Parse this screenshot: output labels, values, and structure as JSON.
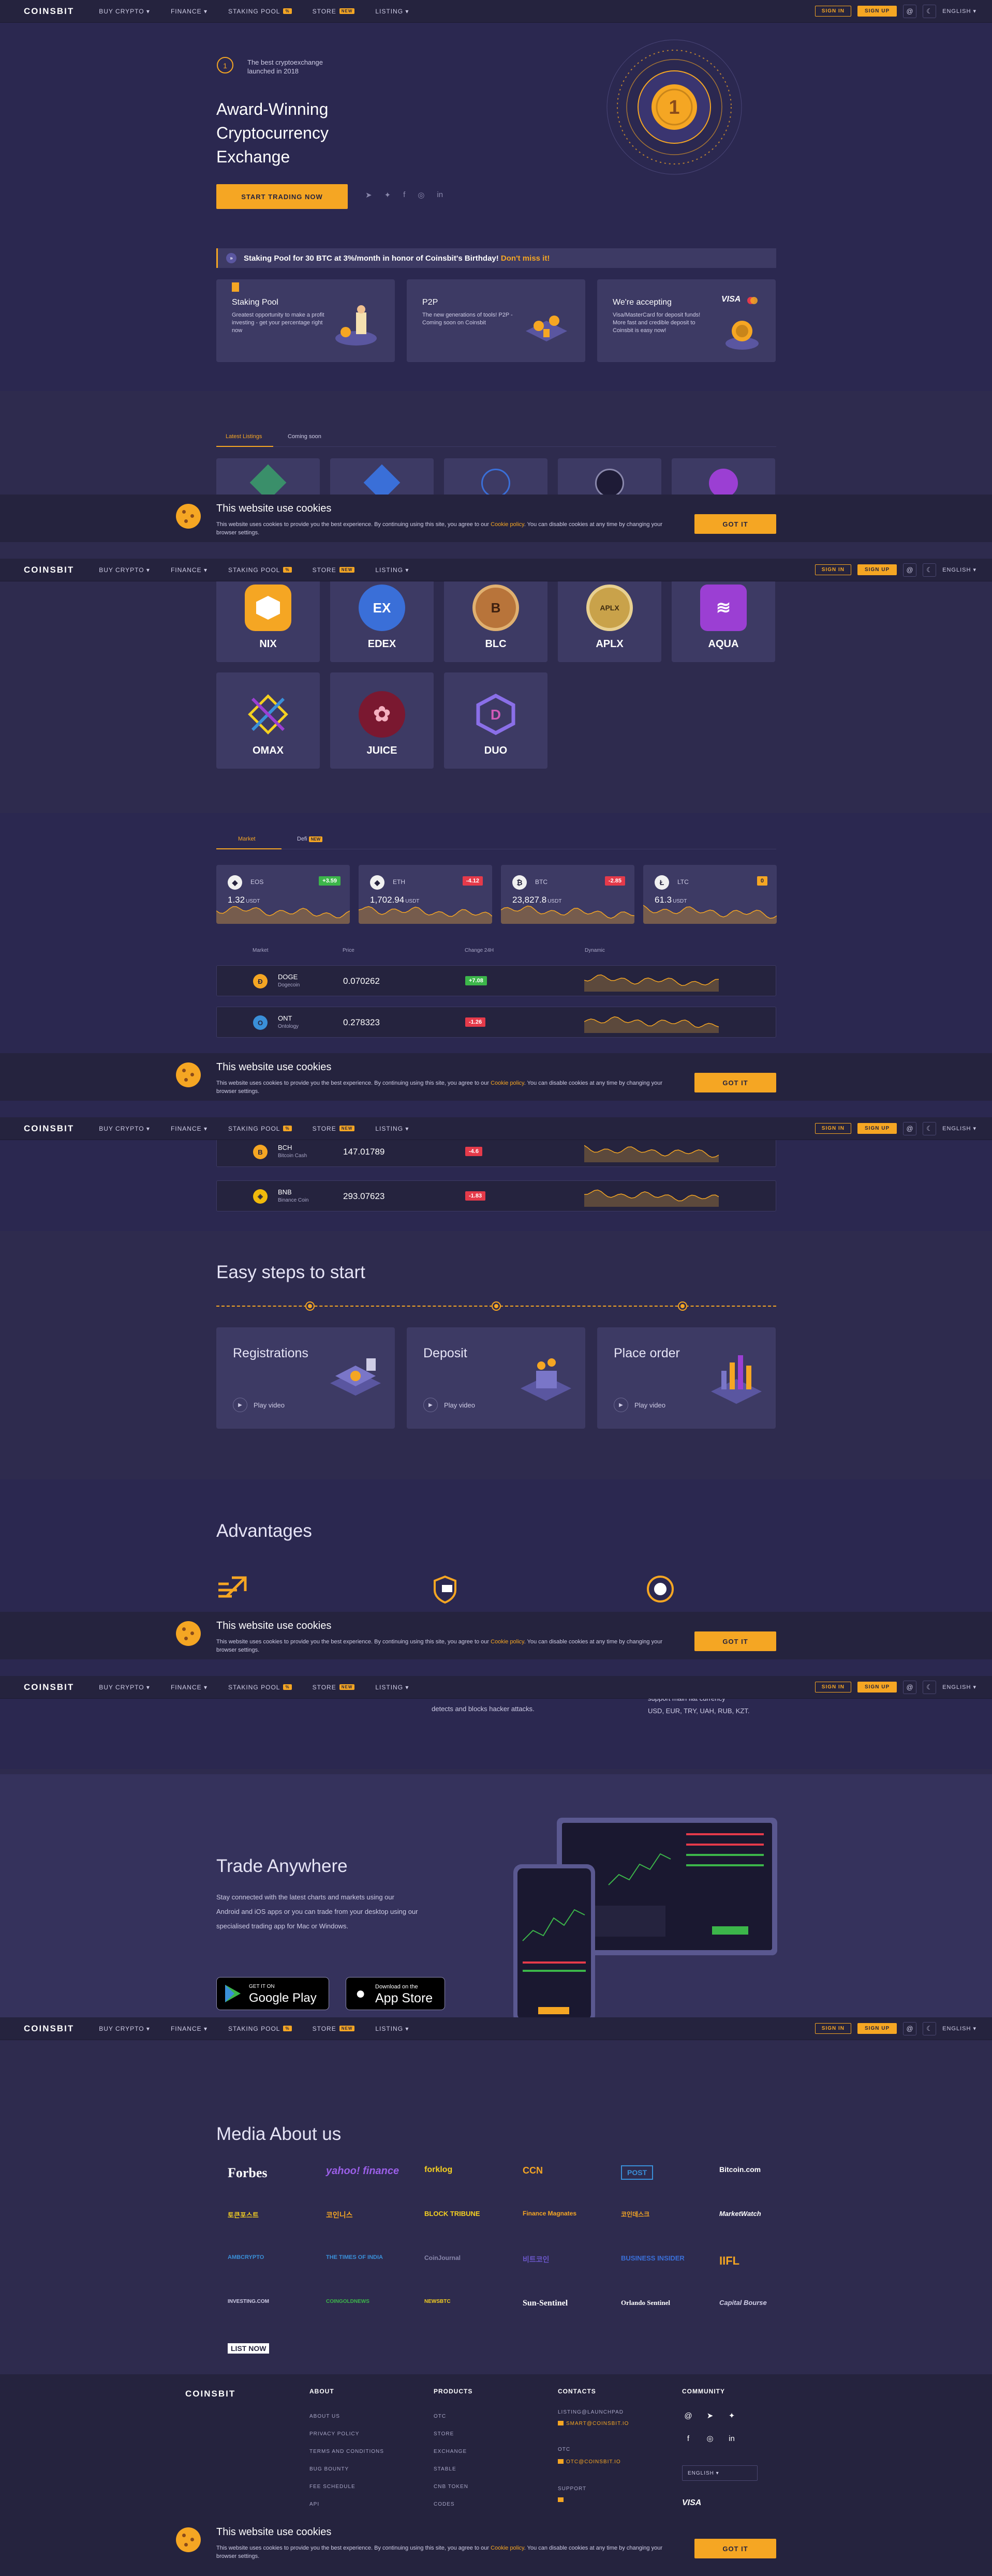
{
  "header": {
    "logo": "COINSBIT",
    "nav": [
      {
        "label": "BUY CRYPTO ▾"
      },
      {
        "label": "FINANCE ▾"
      },
      {
        "label": "STAKING POOL",
        "badge": "%"
      },
      {
        "label": "STORE",
        "badge": "NEW"
      },
      {
        "label": "LISTING ▾"
      }
    ],
    "sign_in": "SIGN IN",
    "sign_up": "SIGN UP",
    "language": "ENGLISH ▾"
  },
  "hero": {
    "award_line1": "The best cryptoexchange",
    "award_line2": "launched in 2018",
    "title_line1": "Award-Winning",
    "title_line2": "Cryptocurrency",
    "title_line3": "Exchange",
    "cta": "START TRADING NOW"
  },
  "banner": {
    "text": "Staking Pool for 30 BTC at 3%/month in honor of Coinsbit's Birthday!",
    "link": "Don't miss it!"
  },
  "promos": [
    {
      "title": "Staking Pool",
      "text": "Greatest opportunity to make a profit investing - get your percentage right now"
    },
    {
      "title": "P2P",
      "text": "The new generations of tools! P2P - Coming soon on Coinsbit"
    },
    {
      "title": "We're accepting",
      "text": "Visa/MasterCard for deposit funds! More fast and credible deposit to Coinsbit is easy now!",
      "brand": "VISA"
    }
  ],
  "listings": {
    "tabs": [
      "Latest Listings",
      "Coming soon"
    ],
    "coins": [
      {
        "name": "NIX",
        "color": "#f5a623",
        "letter": "N"
      },
      {
        "name": "EDEX",
        "color": "#3a6fd8",
        "letter": "EX"
      },
      {
        "name": "BLC",
        "color": "#b8743a",
        "letter": "B"
      },
      {
        "name": "APLX",
        "color": "#c9a24a",
        "letter": "A"
      },
      {
        "name": "AQUA",
        "color": "#9b3fd3",
        "letter": "≋"
      },
      {
        "name": "OMAX",
        "color": "#3d3a64",
        "letter": "✕"
      },
      {
        "name": "JUICE",
        "color": "#7a1830",
        "letter": "✿"
      },
      {
        "name": "DUO",
        "color": "#6a56c8",
        "letter": "D"
      }
    ]
  },
  "market": {
    "tabs": [
      "Market",
      "Defi"
    ],
    "defi_badge": "NEW",
    "tickers": [
      {
        "icon": "◆",
        "pair": "EOS",
        "change": "+3.59",
        "dir": "up",
        "value": "1.32",
        "unit": "USDT"
      },
      {
        "icon": "◆",
        "pair": "ETH",
        "change": "-4.12",
        "dir": "down",
        "value": "1,702.94",
        "unit": "USDT"
      },
      {
        "icon": "₿",
        "pair": "BTC",
        "change": "-2.85",
        "dir": "down",
        "value": "23,827.8",
        "unit": "USDT"
      },
      {
        "icon": "Ł",
        "pair": "LTC",
        "change": "0",
        "dir": "flat",
        "value": "61.3",
        "unit": "USDT"
      }
    ],
    "columns": [
      "Market",
      "Price",
      "Change 24H",
      "Dynamic"
    ],
    "rows": [
      {
        "sym": "DOGE",
        "name": "Dogecoin",
        "price": "0.070262",
        "change": "+7.08",
        "dir": "up",
        "color": "#f5a623",
        "icon": "Ð"
      },
      {
        "sym": "ONT",
        "name": "Ontology",
        "price": "0.278323",
        "change": "-1.26",
        "dir": "down",
        "color": "#3a8fd8",
        "icon": "O"
      },
      {
        "sym": "BCH",
        "name": "Bitcoin Cash",
        "price": "147.01789",
        "change": "-4.6",
        "dir": "down",
        "color": "#f5a623",
        "icon": "B"
      },
      {
        "sym": "BNB",
        "name": "Binance Coin",
        "price": "293.07623",
        "change": "-1.83",
        "dir": "down",
        "color": "#f0b90b",
        "icon": "◈"
      }
    ]
  },
  "steps": {
    "title": "Easy steps to start",
    "items": [
      {
        "title": "Registrations",
        "play": "Play video"
      },
      {
        "title": "Deposit",
        "play": "Play video"
      },
      {
        "title": "Place order",
        "play": "Play video"
      }
    ]
  },
  "advantages": {
    "title": "Advantages",
    "text1": "detects and blocks hacker attacks.",
    "text2_line1": "support main fiat currency",
    "text2_line2": "USD, EUR, TRY, UAH, RUB, KZT."
  },
  "trade": {
    "title": "Trade Anywhere",
    "text_line1": "Stay connected with the latest charts and markets using our",
    "text_line2": "Android and iOS apps or you can trade from your desktop using our",
    "text_line3": "specialised trading app for Mac or Windows.",
    "gp_small": "GET IT ON",
    "gp_big": "Google Play",
    "as_small": "Download on the",
    "as_big": "App Store"
  },
  "media": {
    "title": "Media About us",
    "logos": [
      "Forbes",
      "yahoo! finance",
      "forklog",
      "CCN",
      "POST",
      "Bitcoin.com",
      "토큰포스트",
      "코인니스",
      "BLOCK TRIBUNE",
      "Finance Magnates",
      "코인데스크",
      "MarketWatch",
      "AMBCRYPTO",
      "THE TIMES OF INDIA",
      "CoinJournal",
      "비트코인",
      "BUSINESS INSIDER",
      "IIFL",
      "INVESTING.COM",
      "COINGOLDNEWS",
      "NEWSBTC",
      "Sun-Sentinel",
      "Orlando Sentinel",
      "Capital Bourse",
      "LIST NOW"
    ]
  },
  "footer": {
    "logo": "COINSBIT",
    "about": {
      "title": "ABOUT",
      "links": [
        "ABOUT US",
        "PRIVACY POLICY",
        "TERMS AND CONDITIONS",
        "BUG BOUNTY",
        "FEE SCHEDULE",
        "API"
      ]
    },
    "products": {
      "title": "PRODUCTS",
      "links": [
        "OTC",
        "STORE",
        "EXCHANGE",
        "STABLE",
        "CNB TOKEN",
        "CODES"
      ]
    },
    "contacts": {
      "title": "CONTACTS",
      "label1": "LISTING@LAUNCHPAD",
      "email1": "SMART@COINSBIT.IO",
      "label2": "OTC",
      "email2": "OTC@COINSBIT.IO",
      "label3": "SUPPORT"
    },
    "community": {
      "title": "COMMUNITY",
      "language": "ENGLISH ▾",
      "brand": "VISA"
    }
  },
  "cookie": {
    "title": "This website use cookies",
    "text": "This website uses cookies to provide you the best experience. By continuing using this site, you agree to our",
    "link": "Cookie policy",
    "text2": ". You can disable cookies at any time by changing your browser settings.",
    "button": "GOT IT"
  }
}
